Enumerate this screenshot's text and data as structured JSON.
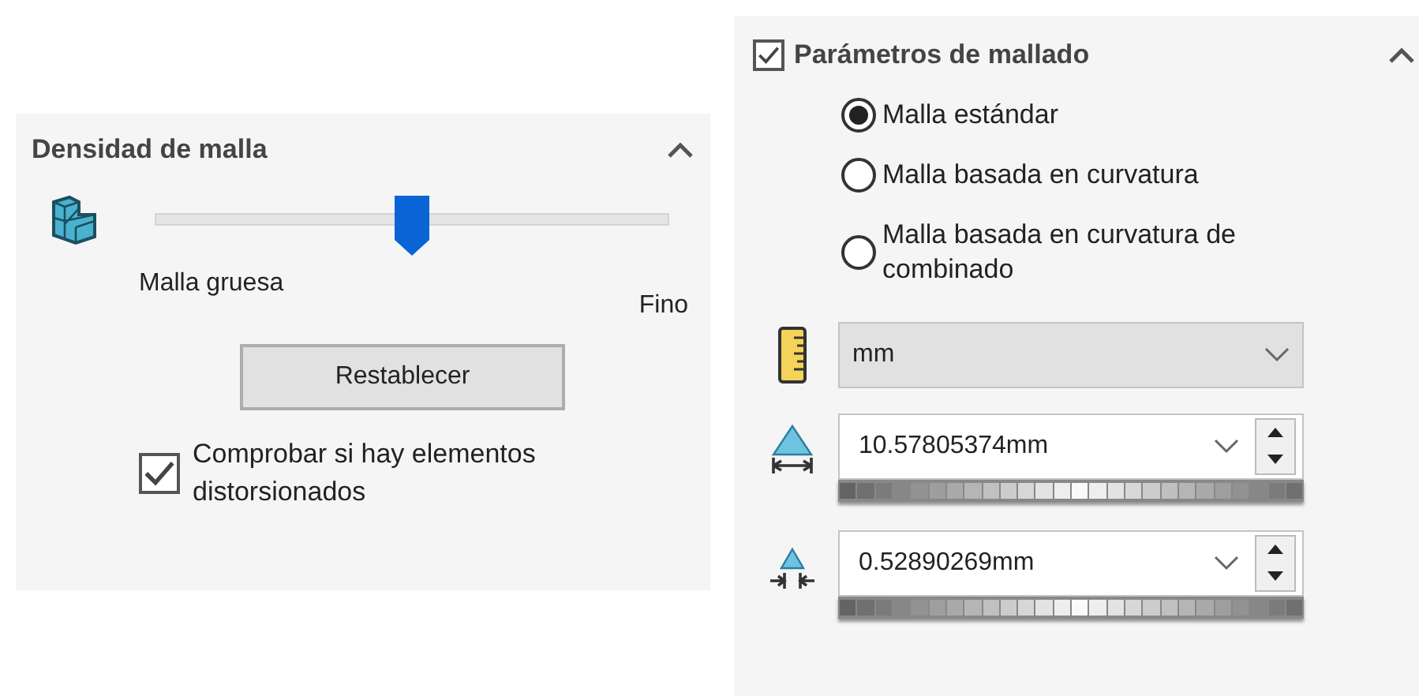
{
  "density_panel": {
    "title": "Densidad de malla",
    "expanded": true,
    "slider": {
      "level": 0.5
    },
    "min_label": "Malla gruesa",
    "max_label": "Fino",
    "reset_button": "Restablecer",
    "check": {
      "label": "Comprobar si hay elementos distorsionados",
      "checked": true
    }
  },
  "params_panel": {
    "title": "Parámetros de mallado",
    "checked": true,
    "expanded": true,
    "options": [
      {
        "label": "Malla estándar",
        "selected": true
      },
      {
        "label": "Malla basada en curvatura",
        "selected": false
      },
      {
        "label": "Malla basada en curvatura de combinado",
        "selected": false
      }
    ],
    "unit": "mm",
    "fields": [
      {
        "kind": "size",
        "value": "10.57805374mm"
      },
      {
        "kind": "tolerance",
        "value": "0.52890269mm"
      }
    ]
  }
}
